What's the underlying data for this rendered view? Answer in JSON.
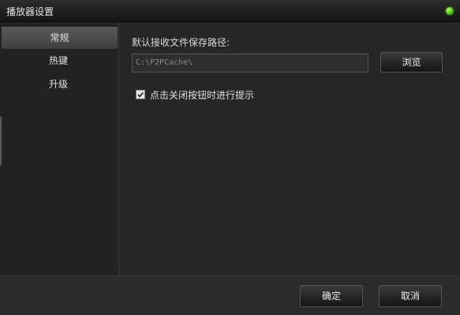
{
  "window": {
    "title": "播放器设置",
    "status_color": "#3fbf12"
  },
  "sidebar": {
    "items": [
      {
        "label": "常规",
        "active": true
      },
      {
        "label": "热键",
        "active": false
      },
      {
        "label": "升级",
        "active": false
      }
    ]
  },
  "general": {
    "path_label": "默认接收文件保存路径:",
    "path_value": "C:\\P2PCache\\",
    "browse_label": "浏览",
    "confirm_on_close_label": "点击关闭按钮时进行提示",
    "confirm_on_close_checked": true
  },
  "footer": {
    "ok_label": "确定",
    "cancel_label": "取消"
  }
}
